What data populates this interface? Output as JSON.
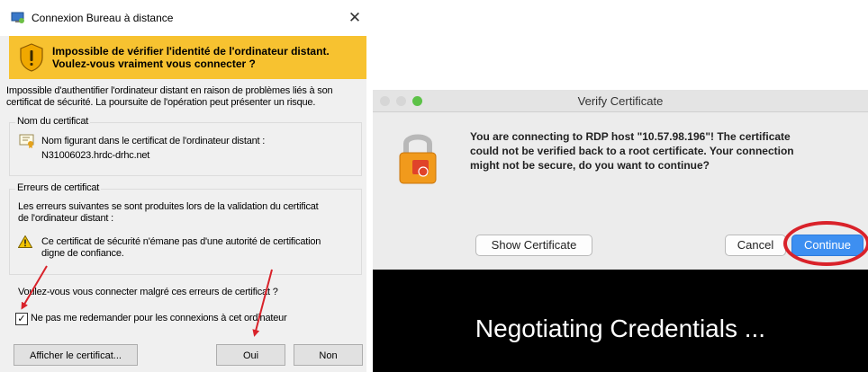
{
  "windows_dialog": {
    "title": "Connexion Bureau à distance",
    "close_glyph": "✕",
    "banner_line1": "Impossible de vérifier l'identité de l'ordinateur distant.",
    "banner_line2": "Voulez-vous vraiment vous connecter ?",
    "desc_line1": "Impossible d'authentifier l'ordinateur distant en raison de problèmes liés à son",
    "desc_line2": "certificat de sécurité. La poursuite de l'opération peut présenter un risque.",
    "cert_group_label": "Nom du certificat",
    "cert_name_label": "Nom figurant dans le certificat de l'ordinateur distant :",
    "cert_name_value": "N31006023.hrdc-drhc.net",
    "errors_group_label": "Erreurs de certificat",
    "errors_intro_line1": "Les erreurs suivantes se sont produites lors de la validation du certificat",
    "errors_intro_line2": "de l'ordinateur distant :",
    "error_line1": "Ce certificat de sécurité n'émane pas d'une autorité de certification",
    "error_line2": "digne de confiance.",
    "question": "Voulez-vous vous connecter malgré ces erreurs de certificat ?",
    "dont_ask_label": "Ne pas me redemander pour les connexions à cet ordinateur",
    "dont_ask_checked": true,
    "check_glyph": "✓",
    "view_cert_button": "Afficher le certificat...",
    "yes_button": "Oui",
    "no_button": "Non"
  },
  "mac_dialog": {
    "title": "Verify Certificate",
    "message_line1": "You are connecting to RDP host \"10.57.98.196\"! The certificate",
    "message_line2": "could not be verified back to a root certificate. Your connection",
    "message_line3": "might not be secure, do you want to continue?",
    "show_cert_button": "Show Certificate",
    "cancel_button": "Cancel",
    "continue_button": "Continue",
    "status_text": "Negotiating Credentials ..."
  },
  "colors": {
    "banner": "#f7c230",
    "annotation_red": "#d9222a",
    "mac_primary": "#3d8ff1"
  }
}
